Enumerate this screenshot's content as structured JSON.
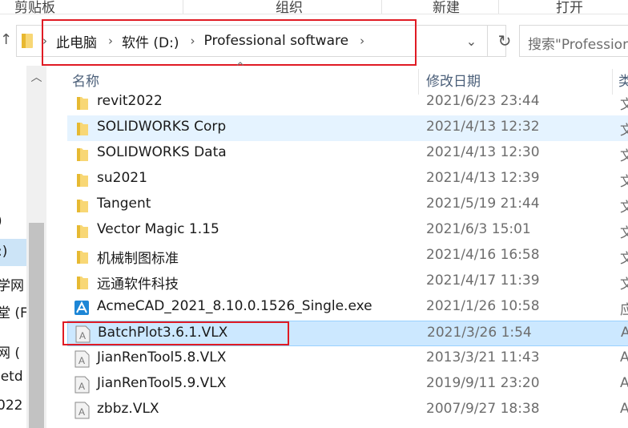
{
  "ribbon": {
    "groups": [
      "剪贴板",
      "组织",
      "新建",
      "打开"
    ]
  },
  "address": {
    "crumbs": [
      "此电脑",
      "软件 (D:)",
      "Professional software"
    ],
    "dropdown_glyph": "⌄",
    "refresh_glyph": "↻"
  },
  "search": {
    "placeholder": "搜索\"Professional software\""
  },
  "nav_pane": {
    "items": [
      ")",
      ":)",
      "学网",
      "堂 (F",
      "网 (",
      "ietd",
      "022"
    ]
  },
  "columns": {
    "name": "名称",
    "date": "修改日期",
    "type": "类型"
  },
  "files": [
    {
      "name": "revit2022",
      "date": "2021/6/23 23:44",
      "type": "文",
      "kind": "folder"
    },
    {
      "name": "SOLIDWORKS Corp",
      "date": "2021/4/13 12:32",
      "type": "文",
      "kind": "folder"
    },
    {
      "name": "SOLIDWORKS Data",
      "date": "2021/4/13 12:30",
      "type": "文",
      "kind": "folder"
    },
    {
      "name": "su2021",
      "date": "2021/4/13 12:39",
      "type": "文",
      "kind": "folder"
    },
    {
      "name": "Tangent",
      "date": "2021/5/19 21:44",
      "type": "文",
      "kind": "folder"
    },
    {
      "name": "Vector Magic 1.15",
      "date": "2021/6/3 15:01",
      "type": "文",
      "kind": "folder"
    },
    {
      "name": "机械制图标准",
      "date": "2021/4/16 16:58",
      "type": "文",
      "kind": "folder"
    },
    {
      "name": "远通软件科技",
      "date": "2021/4/17 11:39",
      "type": "文",
      "kind": "folder"
    },
    {
      "name": "AcmeCAD_2021_8.10.0.1526_Single.exe",
      "date": "2021/1/26 10:58",
      "type": "应",
      "kind": "exe"
    },
    {
      "name": "BatchPlot3.6.1.VLX",
      "date": "2021/3/26 1:54",
      "type": "A",
      "kind": "vlx"
    },
    {
      "name": "JianRenTool5.8.VLX",
      "date": "2013/3/21 11:43",
      "type": "A",
      "kind": "vlx"
    },
    {
      "name": "JianRenTool5.9.VLX",
      "date": "2019/9/11 23:20",
      "type": "A",
      "kind": "vlx"
    },
    {
      "name": "zbbz.VLX",
      "date": "2007/9/27 18:38",
      "type": "A",
      "kind": "vlx"
    }
  ],
  "colors": {
    "highlight": "#e01b24",
    "selection": "#cce8ff",
    "hover": "#e5f3ff",
    "folder": "#f8d775"
  }
}
